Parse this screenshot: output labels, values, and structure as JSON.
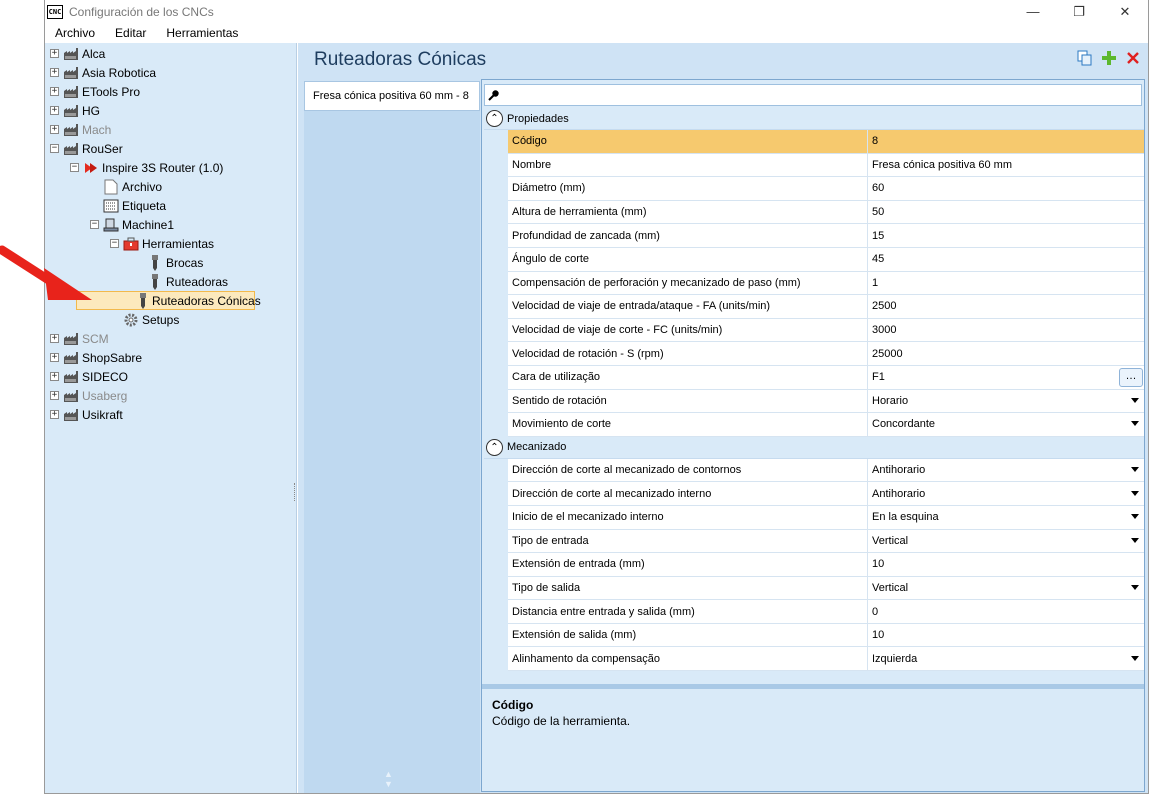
{
  "window": {
    "icon_text": "CNC",
    "title": "Configuración de los CNCs",
    "controls": [
      "—",
      "❐",
      "✕"
    ]
  },
  "menu": [
    "Archivo",
    "Editar",
    "Herramientas"
  ],
  "tree": [
    {
      "label": "Alca",
      "toggle": "+",
      "dim": false
    },
    {
      "label": "Asia Robotica",
      "toggle": "+",
      "dim": false
    },
    {
      "label": "ETools Pro",
      "toggle": "+",
      "dim": false
    },
    {
      "label": "HG",
      "toggle": "+",
      "dim": false
    },
    {
      "label": "Mach",
      "toggle": "+",
      "dim": true
    },
    {
      "label": "RouSer",
      "toggle": "−",
      "dim": false
    },
    {
      "label": "Inspire 3S Router (1.0)",
      "toggle": "−",
      "dim": false
    },
    {
      "label": "Archivo",
      "toggle": "",
      "dim": false
    },
    {
      "label": "Etiqueta",
      "toggle": "",
      "dim": false
    },
    {
      "label": "Machine1",
      "toggle": "−",
      "dim": false
    },
    {
      "label": "Herramientas",
      "toggle": "−",
      "dim": false
    },
    {
      "label": "Brocas",
      "toggle": "",
      "dim": false
    },
    {
      "label": "Ruteadoras",
      "toggle": "",
      "dim": false
    },
    {
      "label": "Ruteadoras Cónicas",
      "toggle": "",
      "dim": false,
      "selected": true
    },
    {
      "label": "Setups",
      "toggle": "",
      "dim": false
    },
    {
      "label": "SCM",
      "toggle": "+",
      "dim": true
    },
    {
      "label": "ShopSabre",
      "toggle": "+",
      "dim": false
    },
    {
      "label": "SIDECO",
      "toggle": "+",
      "dim": false
    },
    {
      "label": "Usaberg",
      "toggle": "+",
      "dim": true
    },
    {
      "label": "Usikraft",
      "toggle": "+",
      "dim": false
    }
  ],
  "page": {
    "title": "Ruteadoras Cónicas"
  },
  "tool_list": {
    "selected_item": "Fresa cónica positiva 60 mm - 8"
  },
  "search": {
    "placeholder": ""
  },
  "categories": [
    {
      "label": "Propiedades",
      "rows": [
        {
          "name": "Código",
          "value": "8",
          "selected": true
        },
        {
          "name": "Nombre",
          "value": "Fresa cónica positiva 60 mm"
        },
        {
          "name": "Diámetro (mm)",
          "value": "60"
        },
        {
          "name": "Altura de herramienta (mm)",
          "value": "50"
        },
        {
          "name": "Profundidad de zancada (mm)",
          "value": "15"
        },
        {
          "name": "Ángulo de corte",
          "value": "45"
        },
        {
          "name": "Compensación de perforación y mecanizado de paso (mm)",
          "value": "1"
        },
        {
          "name": "Velocidad de viaje de entrada/ataque - FA (units/min)",
          "value": "2500"
        },
        {
          "name": "Velocidad de viaje de corte - FC (units/min)",
          "value": "3000"
        },
        {
          "name": "Velocidad de rotación - S (rpm)",
          "value": "25000"
        },
        {
          "name": "Cara de utilização",
          "value": "F1",
          "ellipsis": true
        },
        {
          "name": "Sentido de rotación",
          "value": "Horario",
          "dropdown": true
        },
        {
          "name": "Movimiento de corte",
          "value": "Concordante",
          "dropdown": true
        }
      ]
    },
    {
      "label": "Mecanizado",
      "rows": [
        {
          "name": "Dirección de corte al mecanizado de contornos",
          "value": "Antihorario",
          "dropdown": true
        },
        {
          "name": "Dirección de corte al mecanizado interno",
          "value": "Antihorario",
          "dropdown": true
        },
        {
          "name": "Inicio de el mecanizado interno",
          "value": "En la esquina",
          "dropdown": true
        },
        {
          "name": "Tipo de entrada",
          "value": "Vertical",
          "dropdown": true
        },
        {
          "name": "Extensión de entrada (mm)",
          "value": "10"
        },
        {
          "name": "Tipo de salida",
          "value": "Vertical",
          "dropdown": true
        },
        {
          "name": "Distancia entre entrada y salida (mm)",
          "value": "0"
        },
        {
          "name": "Extensión de salida (mm)",
          "value": "10"
        },
        {
          "name": "Alinhamento da compensação",
          "value": "Izquierda",
          "dropdown": true
        }
      ]
    }
  ],
  "help": {
    "title": "Código",
    "text": "Código de la herramienta."
  },
  "colors": {
    "accent_selection": "#f6c96e",
    "panel_bg": "#d9eaf8",
    "arrow": "#e8231b"
  }
}
